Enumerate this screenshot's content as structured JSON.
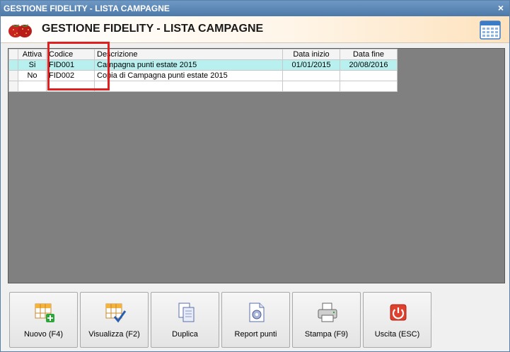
{
  "window": {
    "title": "GESTIONE FIDELITY - LISTA CAMPAGNE",
    "close_glyph": "×"
  },
  "header": {
    "title": "GESTIONE FIDELITY - LISTA CAMPAGNE",
    "logo_icon": "strawberry-icon",
    "calendar_icon": "calendar-icon"
  },
  "grid": {
    "columns": [
      "Attiva",
      "Codice",
      "Descrizione",
      "Data inizio",
      "Data fine"
    ],
    "rows": [
      {
        "attiva": "Si",
        "codice": "FID001",
        "descrizione": "Campagna punti estate 2015",
        "data_inizio": "01/01/2015",
        "data_fine": "20/08/2016",
        "selected": true
      },
      {
        "attiva": "No",
        "codice": "FID002",
        "descrizione": "Copia di Campagna punti estate 2015",
        "data_inizio": "",
        "data_fine": "",
        "selected": false
      },
      {
        "attiva": "",
        "codice": "",
        "descrizione": "",
        "data_inizio": "",
        "data_fine": "",
        "selected": false
      }
    ],
    "selection_color": "#b7f0ef",
    "highlight_color": "#e02020"
  },
  "toolbar": {
    "nuovo": "Nuovo (F4)",
    "visualizza": "Visualizza (F2)",
    "duplica": "Duplica",
    "report": "Report punti",
    "stampa": "Stampa (F9)",
    "uscita": "Uscita (ESC)"
  }
}
